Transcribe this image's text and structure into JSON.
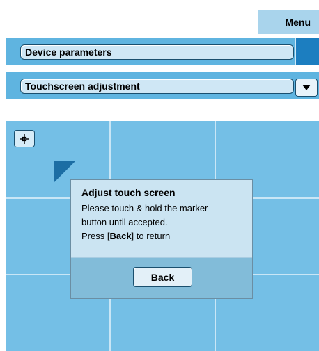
{
  "header": {
    "menu_label": "Menu"
  },
  "rows": [
    {
      "label": "Device parameters"
    },
    {
      "label": "Touchscreen adjustment"
    }
  ],
  "dialog": {
    "title": "Adjust touch screen",
    "line1": "Please touch & hold the marker",
    "line2": "button until accepted.",
    "line3_prefix": "Press [",
    "line3_bold": "Back",
    "line3_suffix": "] to return",
    "back_label": "Back"
  },
  "icons": {
    "crosshair": "crosshair-icon",
    "dropdown": "triangle-down-icon",
    "marker": "calibration-marker"
  },
  "colors": {
    "accent": "#1c7ec0",
    "screen_bg": "#74bfe6",
    "row_bg": "#5fb4e0",
    "dialog_bg": "#cbe4f2"
  }
}
